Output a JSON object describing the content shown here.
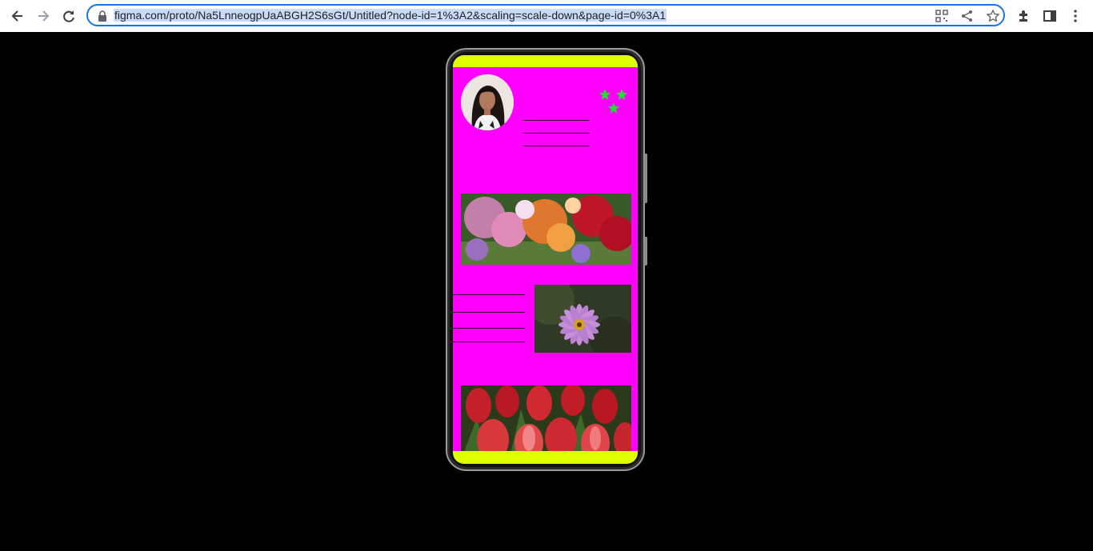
{
  "browser": {
    "url": "figma.com/proto/Na5LnneogpUaABGH2S6sGt/Untitled?node-id=1%3A2&scaling=scale-down&page-id=0%3A1",
    "icons": [
      "back-icon",
      "forward-icon",
      "reload-icon",
      "lock-icon",
      "qr-code-icon",
      "share-icon",
      "bookmark-star-icon",
      "extensions-icon",
      "side-panel-icon",
      "more-menu-icon"
    ]
  },
  "prototype": {
    "colors": {
      "background": "#ff00ff",
      "bars": "#ddff00",
      "stars": "#22dd33"
    },
    "star_count": 3,
    "images": [
      "profile-photo",
      "flower-garden-image",
      "purple-daisy-image",
      "red-tulips-image"
    ]
  }
}
